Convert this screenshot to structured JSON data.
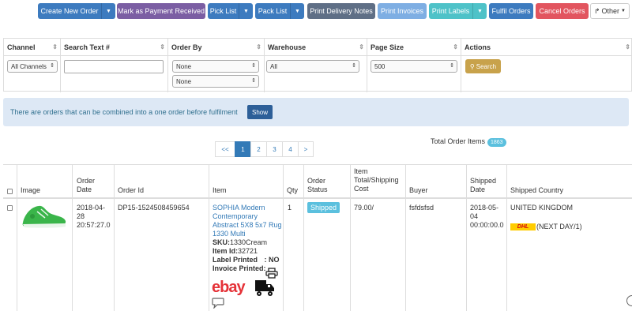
{
  "toolbar": {
    "create_new_order": "Create New Order",
    "mark_payment": "Mark as Payment Received",
    "pick_list": "Pick List",
    "pack_list": "Pack List",
    "print_delivery_notes": "Print Delivery Notes",
    "print_invoices": "Print Invoices",
    "print_labels": "Print Labels",
    "fulfil_orders": "Fulfil Orders",
    "cancel_orders": "Cancel Orders",
    "other": "Other"
  },
  "filters": {
    "channel": {
      "label": "Channel",
      "value": "All Channels"
    },
    "search": {
      "label": "Search Text #",
      "value": ""
    },
    "order_by": {
      "label": "Order By",
      "value1": "None",
      "value2": "None"
    },
    "warehouse": {
      "label": "Warehouse",
      "value": "All"
    },
    "page_size": {
      "label": "Page Size",
      "value": "500"
    },
    "actions": {
      "label": "Actions",
      "search_button": "Search"
    }
  },
  "alert": {
    "message": "There are orders that can be combined into a one order before fulfilment",
    "show_button": "Show"
  },
  "pagination": {
    "prev": "<<",
    "pages": [
      "1",
      "2",
      "3",
      "4"
    ],
    "next": ">",
    "active_page": "1"
  },
  "totals": {
    "label": "Total Order Items",
    "count": "1863"
  },
  "table": {
    "columns": {
      "image": "Image",
      "order_date": "Order Date",
      "order_id": "Order Id",
      "item": "Item",
      "qty": "Qty",
      "order_status": "Order Status",
      "item_total": "Item Total/Shipping Cost",
      "buyer": "Buyer",
      "shipped_date": "Shipped Date",
      "shipped_country": "Shipped Country"
    },
    "rows": [
      {
        "order_date_line1": "2018-04-",
        "order_date_line2": "28",
        "order_date_line3": "20:57:27.0",
        "order_id": "DP15-1524508459654",
        "item_title_1": "SOPHIA Modern",
        "item_title_2": "Contemporary",
        "item_title_3": "Abstract 5X8 5x7 Rug",
        "item_title_4": "1330 Multi",
        "sku_label": "SKU:",
        "sku_value": "1330Cream",
        "item_id_label": "Item Id:",
        "item_id_value": "32721",
        "label_printed_label": "Label Printed",
        "label_printed_value": ": NO",
        "invoice_printed_label": "Invoice Printed:",
        "qty": "1",
        "status": "Shipped",
        "total": "79.00/",
        "buyer": "fsfdsfsd",
        "shipped_date_line1": "2018-05-",
        "shipped_date_line2": "04",
        "shipped_date_line3": "00:00:00.0",
        "carrier_logo_text": "DHL",
        "shipping_service": "(NEXT DAY/1)",
        "shipped_country": "UNITED KINGDOM",
        "marketplace_logo_text": "ebay"
      }
    ]
  },
  "colors": {
    "primary": "#3d7bbf",
    "purple": "#7b5ea3",
    "slate": "#5f6f86",
    "light_blue": "#7eaee3",
    "teal": "#4ec2c8",
    "danger": "#e2555f",
    "gold": "#c8a24b",
    "status_info": "#5bc0de",
    "dhl_yellow": "#ffcc00",
    "dhl_red": "#d40511",
    "shoe_green": "#3ab54a"
  }
}
